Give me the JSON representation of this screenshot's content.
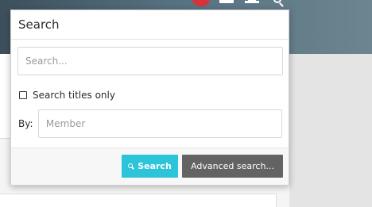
{
  "popup": {
    "title": "Search",
    "search_placeholder": "Search...",
    "titles_only_label": "Search titles only",
    "titles_only_checked": false,
    "by_label": "By:",
    "member_placeholder": "Member",
    "search_button_label": "Search",
    "advanced_button_label": "Advanced search..."
  },
  "colors": {
    "search_button": "#2bc4d9",
    "advanced_button": "#636363",
    "notification_badge": "#d5343a"
  },
  "icons": {
    "search_button_icon": "search-icon",
    "header_icons": [
      "notification-badge-icon",
      "mail-icon",
      "bell-icon",
      "search-icon"
    ]
  }
}
